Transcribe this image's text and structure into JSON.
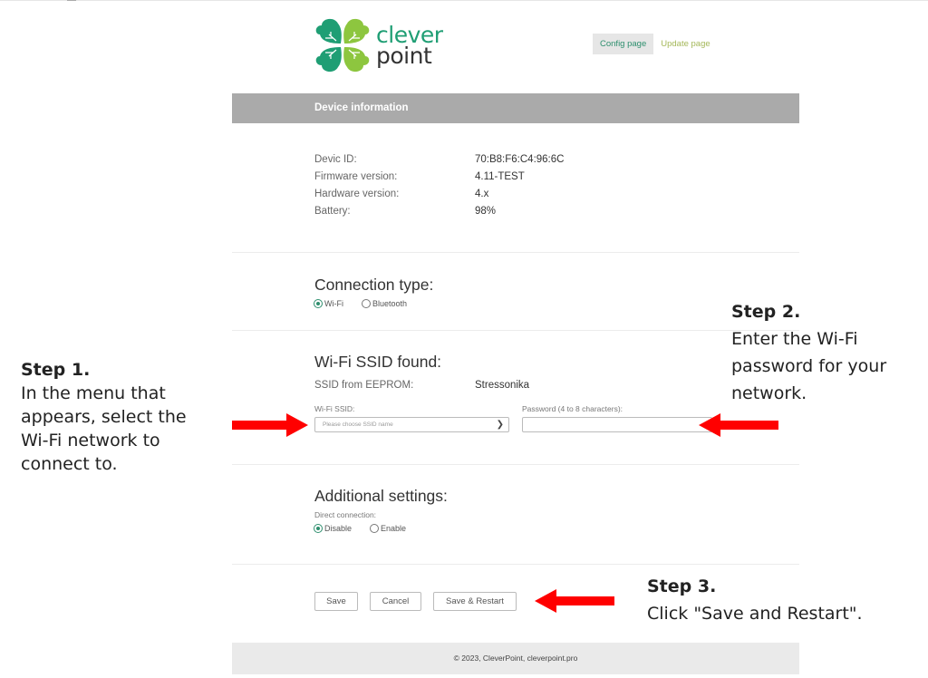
{
  "logo": {
    "line1": "clever",
    "line2": "point"
  },
  "nav": {
    "config_page": "Config page",
    "update_page": "Update page"
  },
  "device_info": {
    "header": "Device information",
    "rows": [
      {
        "label": "Devic ID:",
        "value": "70:B8:F6:C4:96:6C"
      },
      {
        "label": "Firmware version:",
        "value": "4.11-TEST"
      },
      {
        "label": "Hardware version:",
        "value": "4.x"
      },
      {
        "label": "Battery:",
        "value": "98%"
      }
    ]
  },
  "connection": {
    "title": "Connection type:",
    "options": [
      {
        "label": "Wi-Fi",
        "selected": true
      },
      {
        "label": "Bluetooth",
        "selected": false
      }
    ]
  },
  "wifi": {
    "title": "Wi-Fi SSID found:",
    "eeprom_label": "SSID from EEPROM:",
    "eeprom_value": "Stressonika",
    "ssid_label": "Wi-Fi SSID:",
    "ssid_placeholder": "Please choose SSID name",
    "password_label": "Password (4 to 8 characters):",
    "password_value": ""
  },
  "additional": {
    "title": "Additional settings:",
    "direct_label": "Direct connection:",
    "options": [
      {
        "label": "Disable",
        "selected": true
      },
      {
        "label": "Enable",
        "selected": false
      }
    ]
  },
  "buttons": {
    "save": "Save",
    "cancel": "Cancel",
    "save_restart": "Save & Restart"
  },
  "footer": "© 2023, CleverPoint, cleverpoint.pro",
  "steps": [
    {
      "title": "Step 1.",
      "lines": [
        "In the menu that",
        "appears, select the",
        "Wi-Fi network to",
        "connect to."
      ]
    },
    {
      "title": "Step 2.",
      "lines": [
        "Enter the Wi-Fi",
        "password for your",
        "network."
      ]
    },
    {
      "title": "Step 3.",
      "lines": [
        "Click \"Save and Restart\"."
      ]
    }
  ],
  "colors": {
    "brand_green": "#1f9e74",
    "light_green": "#8dc63f",
    "arrow_red": "#ff0000",
    "header_gray": "#aaaaaa"
  }
}
